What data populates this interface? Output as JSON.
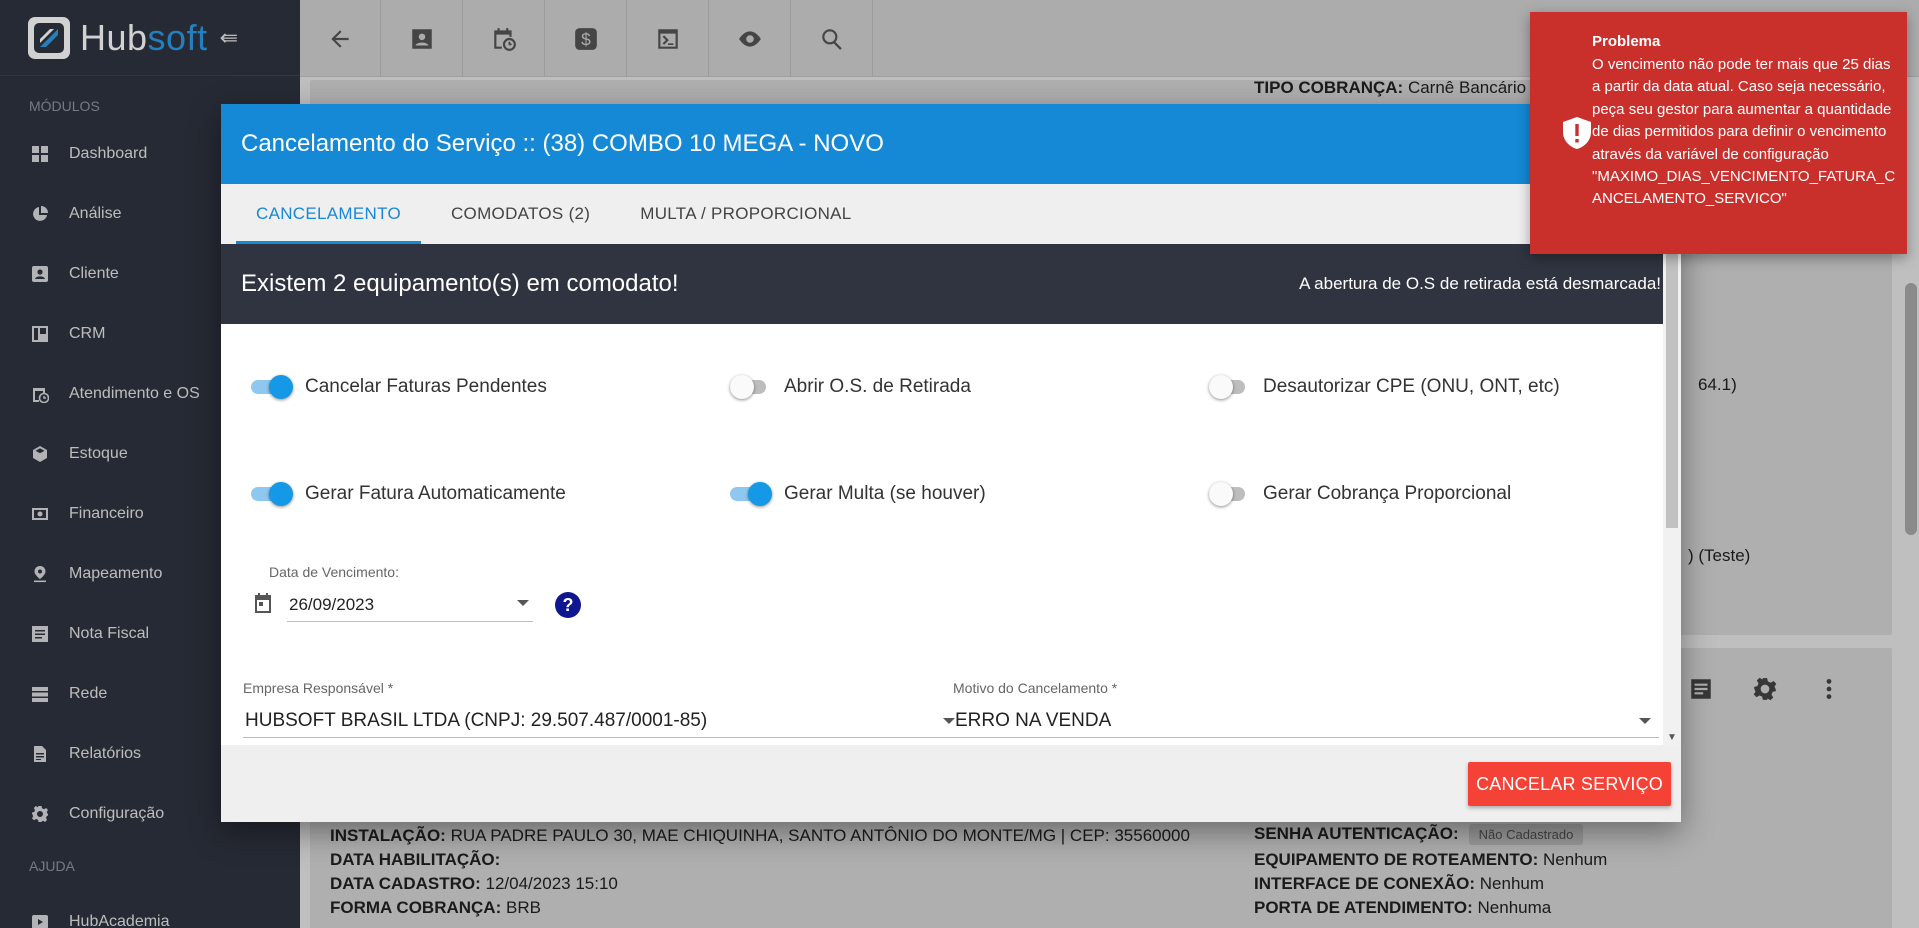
{
  "app": {
    "logo_hub": "Hub",
    "logo_soft": "soft"
  },
  "sidebar": {
    "section_modules": "MÓDULOS",
    "items": [
      {
        "label": "Dashboard",
        "icon": "dashboard-icon"
      },
      {
        "label": "Análise",
        "icon": "pie-chart-icon"
      },
      {
        "label": "Cliente",
        "icon": "contact-card-icon"
      },
      {
        "label": "CRM",
        "icon": "kanban-icon"
      },
      {
        "label": "Atendimento e OS",
        "icon": "calendar-clock-icon"
      },
      {
        "label": "Estoque",
        "icon": "box-icon"
      },
      {
        "label": "Financeiro",
        "icon": "money-icon"
      },
      {
        "label": "Mapeamento",
        "icon": "map-pin-icon"
      },
      {
        "label": "Nota Fiscal",
        "icon": "document-list-icon"
      },
      {
        "label": "Rede",
        "icon": "server-icon"
      },
      {
        "label": "Relatórios",
        "icon": "file-icon"
      },
      {
        "label": "Configuração",
        "icon": "gear-icon"
      }
    ],
    "section_help": "AJUDA",
    "help_items": [
      {
        "label": "HubAcademia",
        "icon": "play-icon"
      }
    ]
  },
  "background": {
    "tipo_cobranca_label": "TIPO COBRANÇA:",
    "tipo_cobranca_value": "Carnê Bancário (a",
    "partial_1": "64.1)",
    "partial_2": ") (Teste)",
    "instalacao_label": "INSTALAÇÃO:",
    "instalacao_value": "RUA PADRE PAULO 30, MAE CHIQUINHA, SANTO ANTÔNIO DO MONTE/MG | CEP: 35560000",
    "data_habilitacao_label": "DATA HABILITAÇÃO:",
    "data_cadastro_label": "DATA CADASTRO:",
    "data_cadastro_value": "12/04/2023 15:10",
    "forma_cobranca_label": "FORMA COBRANÇA:",
    "forma_cobranca_value": "BRB",
    "senha_label": "SENHA AUTENTICAÇÃO:",
    "senha_badge": "Não Cadastrado",
    "equip_label": "EQUIPAMENTO DE ROTEAMENTO:",
    "equip_value": "Nenhum",
    "interface_label": "INTERFACE DE CONEXÃO:",
    "interface_value": "Nenhum",
    "porta_label": "PORTA DE ATENDIMENTO:",
    "porta_value": "Nenhuma"
  },
  "modal": {
    "title": "Cancelamento do Serviço :: (38) COMBO 10 MEGA - NOVO",
    "tabs": [
      {
        "label": "CANCELAMENTO",
        "active": true
      },
      {
        "label": "COMODATOS (2)",
        "active": false
      },
      {
        "label": "MULTA / PROPORCIONAL",
        "active": false
      }
    ],
    "alert_title": "Existem 2 equipamento(s) em comodato!",
    "alert_note": "A abertura de O.S de retirada está desmarcada!",
    "toggles": [
      {
        "label": "Cancelar Faturas Pendentes",
        "on": true
      },
      {
        "label": "Abrir O.S. de Retirada",
        "on": false
      },
      {
        "label": "Desautorizar CPE (ONU, ONT, etc)",
        "on": false
      },
      {
        "label": "Gerar Fatura Automaticamente",
        "on": true
      },
      {
        "label": "Gerar Multa (se houver)",
        "on": true
      },
      {
        "label": "Gerar Cobrança Proporcional",
        "on": false
      }
    ],
    "date_label": "Data de Vencimento:",
    "date_value": "26/09/2023",
    "help_glyph": "?",
    "empresa_label": "Empresa Responsável *",
    "empresa_value": "HUBSOFT BRASIL LTDA (CNPJ: 29.507.487/0001-85)",
    "motivo_label": "Motivo do Cancelamento *",
    "motivo_value": "ERRO NA VENDA",
    "cancel_button": "CANCELAR SERVIÇO"
  },
  "toast": {
    "title": "Problema",
    "message": "O vencimento não pode ter mais que 25 dias a partir da data atual. Caso seja necessário, peça seu gestor para aumentar a quantidade de dias permitidos para definir o vencimento através da variável de configuração \"MAXIMO_DIAS_VENCIMENTO_FATURA_CANCELAMENTO_SERVICO\"",
    "icon": "shield-alert-icon",
    "color": "#c9302c"
  },
  "colors": {
    "primary": "#1589d6",
    "sidebar": "#2f3440",
    "danger": "#f44336"
  }
}
